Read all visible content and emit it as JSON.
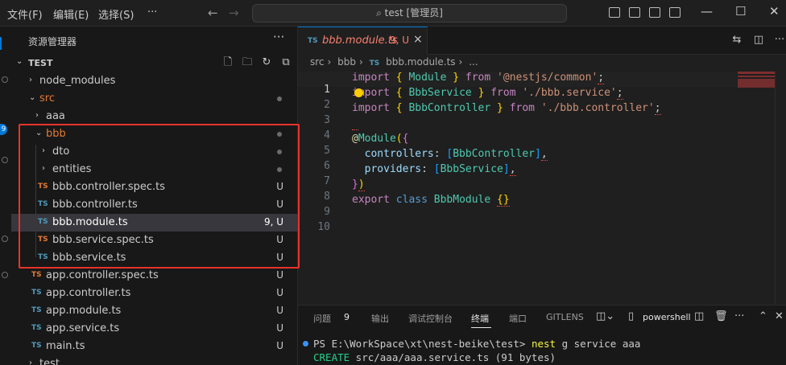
{
  "menu": {
    "file": "文件(F)",
    "edit": "编辑(E)",
    "select": "选择(S)",
    "more": "···"
  },
  "search": {
    "text": "test [管理员]"
  },
  "activity": {
    "badge": "9"
  },
  "sidebar": {
    "title": "资源管理器",
    "more": "···",
    "section": "TEST",
    "items": [
      {
        "name": "node_modules",
        "type": "folder",
        "expanded": false
      },
      {
        "name": "src",
        "type": "folder",
        "expanded": true,
        "color": "#e37933"
      },
      {
        "name": "aaa",
        "type": "folder",
        "expanded": false
      },
      {
        "name": "bbb",
        "type": "folder",
        "expanded": true,
        "color": "#e37933"
      },
      {
        "name": "dto",
        "type": "folder",
        "expanded": false
      },
      {
        "name": "entities",
        "type": "folder",
        "expanded": false
      },
      {
        "name": "bbb.controller.spec.ts",
        "icon": "TS",
        "status": "U"
      },
      {
        "name": "bbb.controller.ts",
        "icon": "TS",
        "status": "U"
      },
      {
        "name": "bbb.module.ts",
        "icon": "TS",
        "status": "9, U"
      },
      {
        "name": "bbb.service.spec.ts",
        "icon": "TS",
        "status": "U"
      },
      {
        "name": "bbb.service.ts",
        "icon": "TS",
        "status": "U"
      },
      {
        "name": "app.controller.spec.ts",
        "icon": "TS",
        "status": "U"
      },
      {
        "name": "app.controller.ts",
        "icon": "TS",
        "status": "U"
      },
      {
        "name": "app.module.ts",
        "icon": "TS",
        "status": "U"
      },
      {
        "name": "app.service.ts",
        "icon": "TS",
        "status": "U"
      },
      {
        "name": "main.ts",
        "icon": "TS",
        "status": "U"
      },
      {
        "name": "test",
        "type": "folder",
        "expanded": false
      }
    ]
  },
  "editor": {
    "tab": {
      "icon": "TS",
      "name": "bbb.module.ts",
      "badge": "9, U",
      "close": "×"
    },
    "breadcrumb": {
      "p1": "src",
      "p2": "bbb",
      "icon": "TS",
      "p3": "bbb.module.ts",
      "p4": "..."
    },
    "line_numbers": [
      "1",
      "2",
      "3",
      "4",
      "5",
      "6",
      "7",
      "8",
      "9",
      "10"
    ]
  },
  "panel": {
    "tabs": {
      "problems": "问题",
      "problems_count": "9",
      "output": "输出",
      "debug": "调试控制台",
      "terminal": "终端",
      "ports": "端口",
      "gitlens": "GITLENS"
    },
    "shell": "powershell",
    "terminal": {
      "prompt": "PS E:\\WorkSpace\\xt\\nest-beike\\test>",
      "command": "nest",
      "args": " g service aaa",
      "create_label": "CREATE",
      "create_text": " src/aaa/aaa.service.ts (91 bytes)"
    }
  }
}
